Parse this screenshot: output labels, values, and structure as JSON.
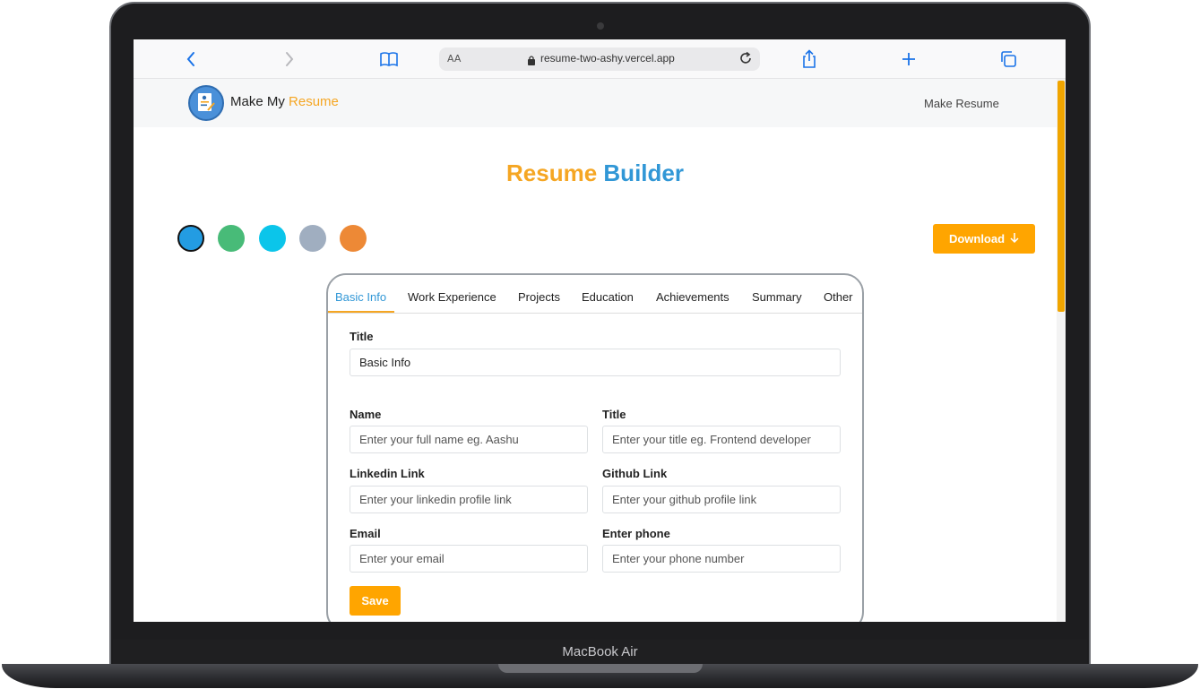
{
  "device": {
    "model_name": "MacBook Air"
  },
  "browser": {
    "text_size_label": "AA",
    "url": "resume-two-ashy.vercel.app",
    "icons": [
      "back-icon",
      "forward-icon",
      "bookmarks-icon",
      "lock-icon",
      "reload-icon",
      "share-icon",
      "new-tab-icon",
      "tabs-icon"
    ]
  },
  "navbar": {
    "brand_prefix": "Make My",
    "brand_accent": "Resume",
    "link": "Make Resume"
  },
  "page": {
    "heading_part1": "Resume",
    "heading_part2": "Builder",
    "download_label": "Download"
  },
  "colors": {
    "accent": "#ffa500",
    "brand_blue": "#3197d6",
    "theme_options": [
      "#239ce2",
      "#48bb78",
      "#0bc5ea",
      "#a0aec0",
      "#ed8936"
    ],
    "active_theme": "#239ce2"
  },
  "tabs": [
    {
      "label": "Basic Info",
      "active": true
    },
    {
      "label": "Work Experience",
      "active": false
    },
    {
      "label": "Projects",
      "active": false
    },
    {
      "label": "Education",
      "active": false
    },
    {
      "label": "Achievements",
      "active": false
    },
    {
      "label": "Summary",
      "active": false
    },
    {
      "label": "Other",
      "active": false
    }
  ],
  "form": {
    "section_title_label": "Title",
    "section_title_value": "Basic Info",
    "name_label": "Name",
    "name_placeholder": "Enter your full name eg. Aashu",
    "title_label": "Title",
    "title_placeholder": "Enter your title eg. Frontend developer",
    "linkedin_label": "Linkedin Link",
    "linkedin_placeholder": "Enter your linkedin profile link",
    "github_label": "Github Link",
    "github_placeholder": "Enter your github profile link",
    "email_label": "Email",
    "email_placeholder": "Enter your email",
    "phone_label": "Enter phone",
    "phone_placeholder": "Enter your phone number",
    "save_label": "Save"
  }
}
